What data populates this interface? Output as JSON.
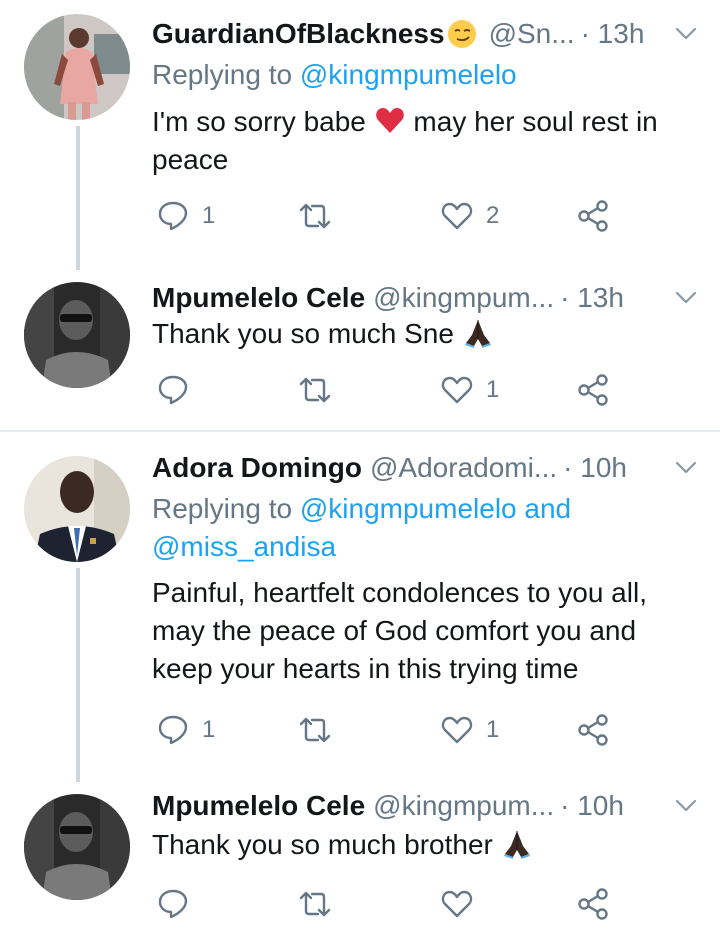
{
  "tweets": [
    {
      "name": "GuardianOfBlackness",
      "handle": "@Sn...",
      "time": "· 13h",
      "replying_label": "Replying to",
      "replying_to": "@kingmpumelelo",
      "text": "I'm so sorry babe",
      "text2": " may her soul rest in peace",
      "emoji": "red-heart-icon",
      "reply_count": "1",
      "retweet_count": "",
      "like_count": "2"
    },
    {
      "name": "Mpumelelo Cele",
      "handle": "@kingmpum...",
      "time": "· 13h",
      "text": "Thank you so much Sne ",
      "emoji": "folded-hands-icon",
      "reply_count": "",
      "retweet_count": "",
      "like_count": "1"
    },
    {
      "name": "Adora Domingo",
      "handle": "@Adoradomi...",
      "time": "· 10h",
      "replying_label": "Replying to",
      "replying_to": "@kingmpumelelo and @miss_andisa",
      "text": "Painful, heartfelt condolences to you all, may the peace of God comfort you and keep your hearts in this trying time",
      "reply_count": "1",
      "retweet_count": "",
      "like_count": "1"
    },
    {
      "name": "Mpumelelo Cele",
      "handle": "@kingmpum...",
      "time": "· 10h",
      "text": "Thank you so much brother ",
      "emoji": "folded-hands-icon",
      "reply_count": "",
      "retweet_count": "",
      "like_count": ""
    }
  ],
  "colors": {
    "accent": "#1da1f2",
    "muted": "#657786",
    "thread_line": "#ccd6dd",
    "divider": "#e6ecf0"
  }
}
